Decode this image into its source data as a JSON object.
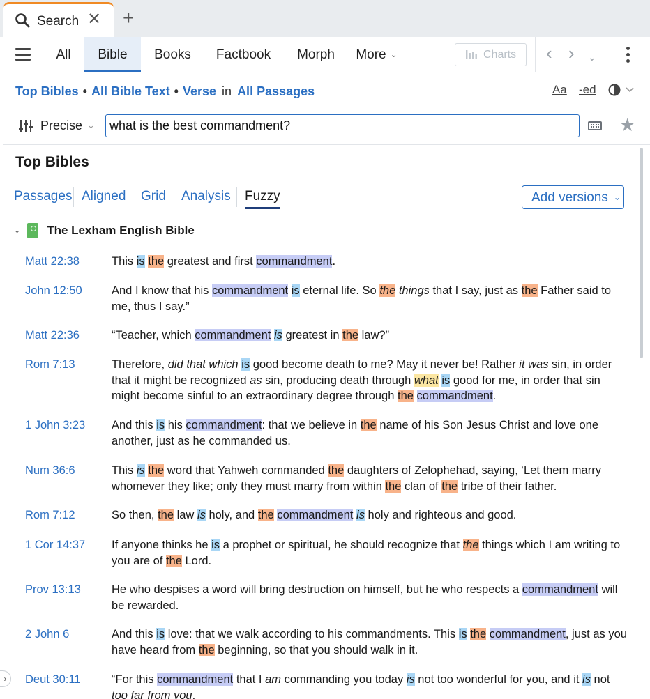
{
  "tab": {
    "title": "Search",
    "close": "✕",
    "new": "+"
  },
  "nav": {
    "tabs": [
      {
        "label": "All"
      },
      {
        "label": "Bible"
      },
      {
        "label": "Books"
      },
      {
        "label": "Factbook"
      },
      {
        "label": "Morph"
      },
      {
        "label": "More"
      }
    ],
    "active_tab": "Bible",
    "charts_label": "Charts"
  },
  "scope": {
    "part1": "Top Bibles",
    "part2": "All Bible Text",
    "part3": "Verse",
    "in_word": "in",
    "part4": "All Passages",
    "sep": "•"
  },
  "tools": {
    "font_label": "Aa",
    "ed_label": "-ed"
  },
  "search": {
    "mode": "Precise",
    "query": "what is the best commandment?"
  },
  "results": {
    "title": "Top Bibles",
    "view_tabs": [
      "Passages",
      "Aligned",
      "Grid",
      "Analysis",
      "Fuzzy"
    ],
    "active_view": "Fuzzy",
    "add_versions": "Add versions",
    "book": "The Lexham English Bible",
    "verses": [
      {
        "ref": "Matt 22:38",
        "text": "This is the greatest and first commandment."
      },
      {
        "ref": "John 12:50",
        "text": "And I know that his commandment is eternal life. So the things that I say, just as the Father said to me, thus I say.”"
      },
      {
        "ref": "Matt 22:36",
        "text": "“Teacher, which commandment is greatest in the law?”"
      },
      {
        "ref": "Rom 7:13",
        "text": "Therefore, did that which is good become death to me? May it never be! Rather it was sin, in order that it might be recognized as sin, producing death through what is good for me, in order that sin might become sinful to an extraordinary degree through the commandment."
      },
      {
        "ref": "1 John 3:23",
        "text": "And this is his commandment: that we believe in the name of his Son Jesus Christ and love one another, just as he commanded us."
      },
      {
        "ref": "Num 36:6",
        "text": "This is the word that Yahweh commanded the daughters of Zelophehad, saying, ‘Let them marry whomever they like; only they must marry from within the clan of the tribe of their father."
      },
      {
        "ref": "Rom 7:12",
        "text": "So then, the law is holy, and the commandment is holy and righteous and good."
      },
      {
        "ref": "1 Cor 14:37",
        "text": "If anyone thinks he is a prophet or spiritual, he should recognize that the things which I am writing to you are of the Lord."
      },
      {
        "ref": "Prov 13:13",
        "text": "He who despises a word will bring destruction on himself, but he who respects a commandment will be rewarded."
      },
      {
        "ref": "2 John 6",
        "text": "And this is love: that we walk according to his commandments. This is the commandment, just as you have heard from the beginning, so that you should walk in it."
      },
      {
        "ref": "Deut 30:11",
        "text": "“For this commandment that I am commanding you today is not too wonderful for you, and it is not too far from you."
      }
    ]
  },
  "colors": {
    "accent": "#2b6fc2",
    "tab_accent": "#f08a24",
    "hl_is": "#a9d6f5",
    "hl_the": "#f8b38a",
    "hl_commandment": "#c6ccf5",
    "hl_what": "#fbe6a2"
  },
  "icons": [
    "search-icon",
    "close-icon",
    "plus-icon",
    "menu-icon",
    "chevron-down-icon",
    "bar-chart-icon",
    "chevron-left-icon",
    "chevron-right-icon",
    "more-vertical-icon",
    "contrast-icon",
    "sliders-icon",
    "keyboard-icon",
    "star-icon",
    "book-icon",
    "chevron-right-icon"
  ]
}
